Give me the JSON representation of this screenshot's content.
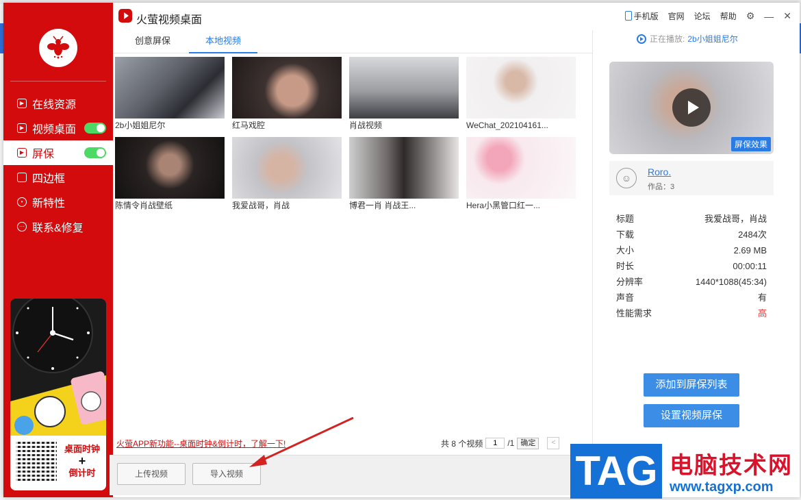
{
  "app": {
    "title": "火萤视频桌面"
  },
  "top_links": {
    "phone": "手机版",
    "site": "官网",
    "forum": "论坛",
    "help": "帮助"
  },
  "sidebar": {
    "items": [
      {
        "label": "在线资源",
        "toggle": false,
        "active": false
      },
      {
        "label": "视频桌面",
        "toggle": true,
        "active": false
      },
      {
        "label": "屏保",
        "toggle": true,
        "active": true
      },
      {
        "label": "四边框",
        "toggle": false,
        "active": false
      },
      {
        "label": "新特性",
        "toggle": false,
        "active": false
      },
      {
        "label": "联系&修复",
        "toggle": false,
        "active": false
      }
    ],
    "promo_line1": "桌面时钟",
    "promo_plus": "+",
    "promo_line2": "倒计时"
  },
  "tabs": {
    "creative": "创意屏保",
    "local": "本地视频"
  },
  "videos": [
    {
      "caption": "2b小姐姐尼尔",
      "tone": "#6b6f78"
    },
    {
      "caption": "红马戏腔",
      "tone": "#3b3433"
    },
    {
      "caption": "肖战视频",
      "tone": "#a9aaad"
    },
    {
      "caption": "WeChat_202104161...",
      "tone": "#e7e4e6"
    },
    {
      "caption": "陈情令肖战壁纸",
      "tone": "#2a2625"
    },
    {
      "caption": "我爱战哥，肖战",
      "tone": "#c9c9cd"
    },
    {
      "caption": "博君一肖 肖战王...",
      "tone": "#8a8585"
    },
    {
      "caption": "Hera小黑管口红一...",
      "tone": "#f2dfe4"
    }
  ],
  "bottom": {
    "news_link": "火萤APP新功能--桌面时钟&倒计时，了解一下!",
    "total_prefix": "共 8 个视频",
    "page_value": "1",
    "page_total": "/1",
    "confirm": "确定",
    "upload": "上传视频",
    "import": "导入视频"
  },
  "now_playing": {
    "label": "正在播放:",
    "value": "2b小姐姐尼尔"
  },
  "preview": {
    "badge": "屏保效果"
  },
  "author": {
    "name": "Roro.",
    "works": "作品：3"
  },
  "info": [
    {
      "k": "标题",
      "v": "我爱战哥，肖战",
      "red": false
    },
    {
      "k": "下载",
      "v": "2484次",
      "red": false
    },
    {
      "k": "大小",
      "v": "2.69 MB",
      "red": false
    },
    {
      "k": "时长",
      "v": "00:00:11",
      "red": false
    },
    {
      "k": "分辨率",
      "v": "1440*1088(45:34)",
      "red": false
    },
    {
      "k": "声音",
      "v": "有",
      "red": false
    },
    {
      "k": "性能需求",
      "v": "高",
      "red": true
    }
  ],
  "actions": {
    "add": "添加到屏保列表",
    "set": "设置视频屏保"
  },
  "watermark": {
    "tag": "TAG",
    "title": "电脑技术网",
    "url": "www.tagxp.com"
  }
}
